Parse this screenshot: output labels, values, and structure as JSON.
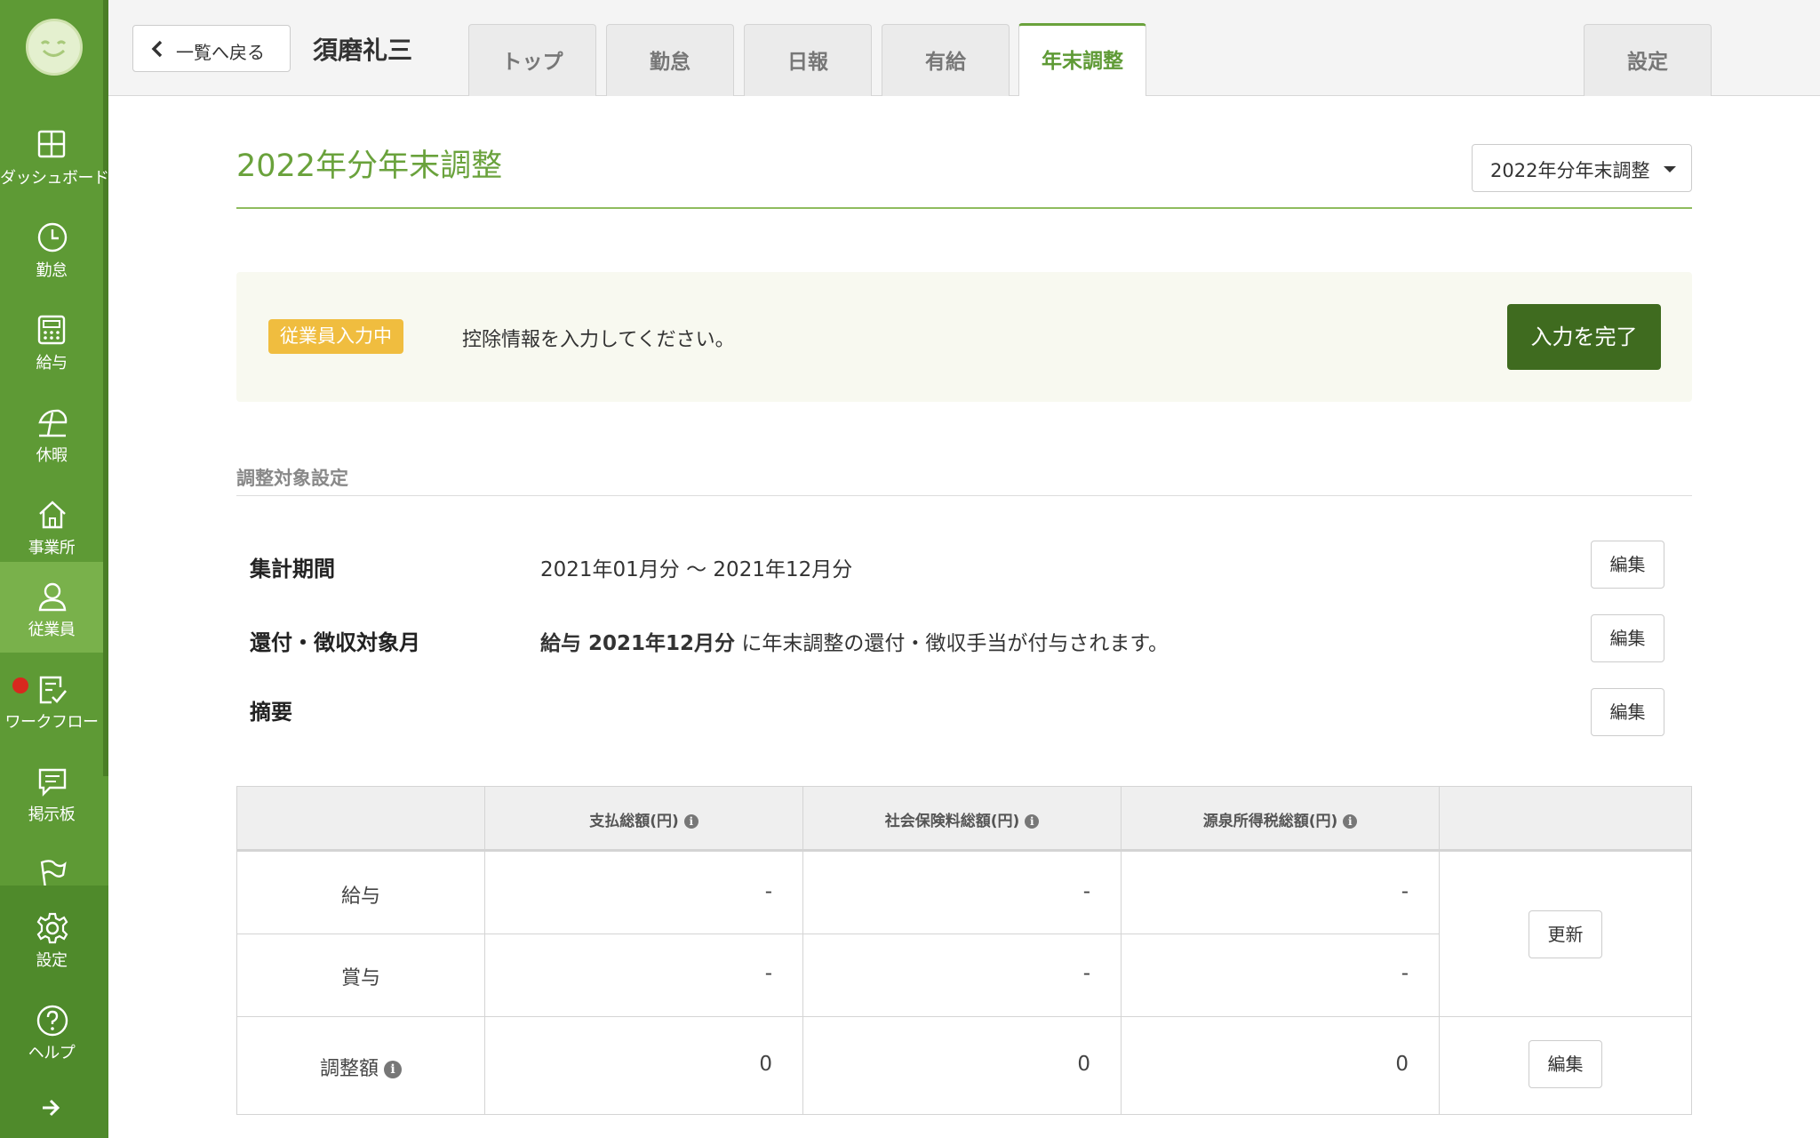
{
  "colors": {
    "sidebar_bg": "#5e9a35",
    "sidebar_active": "#79b14b",
    "accent": "#6aa23c",
    "primary_button": "#3f6b1f",
    "status_badge": "#f0bd3f",
    "notification_dot": "#d8281e"
  },
  "sidebar": {
    "items": [
      {
        "label": "ダッシュボード",
        "icon": "dashboard-icon"
      },
      {
        "label": "勤怠",
        "icon": "clock-icon"
      },
      {
        "label": "給与",
        "icon": "calculator-icon"
      },
      {
        "label": "休暇",
        "icon": "beach-umbrella-icon"
      },
      {
        "label": "事業所",
        "icon": "home-icon"
      },
      {
        "label": "従業員",
        "icon": "person-icon",
        "active": true
      },
      {
        "label": "ワークフロー",
        "icon": "workflow-check-icon",
        "badge": "notification-dot"
      },
      {
        "label": "掲示板",
        "icon": "message-board-icon"
      },
      {
        "label": "",
        "icon": "flag-icon"
      },
      {
        "label": "設定",
        "icon": "gear-icon"
      },
      {
        "label": "ヘルプ",
        "icon": "help-icon"
      }
    ],
    "collapse_icon": "arrow-right-icon"
  },
  "header": {
    "back_label": "一覧へ戻る",
    "employee_name": "須磨礼三",
    "tabs": [
      "トップ",
      "勤怠",
      "日報",
      "有給",
      "年末調整"
    ],
    "active_tab": "年末調整",
    "settings_tab": "設定"
  },
  "main": {
    "title": "2022年分年末調整",
    "year_select": "2022年分年末調整",
    "status": {
      "badge": "従業員入力中",
      "message": "控除情報を入力してください。",
      "complete_button": "入力を完了"
    },
    "section_title": "調整対象設定",
    "rows": {
      "period": {
        "label": "集計期間",
        "value": "2021年01月分 〜 2021年12月分",
        "edit": "編集"
      },
      "refund": {
        "label": "還付・徴収対象月",
        "value_bold": "給与 2021年12月分",
        "value_rest": " に年末調整の還付・徴収手当が付与されます。",
        "edit": "編集"
      },
      "summary": {
        "label": "摘要",
        "edit": "編集"
      }
    },
    "table": {
      "headers": [
        "支払総額(円)",
        "社会保険料総額(円)",
        "源泉所得税総額(円)"
      ],
      "rows": [
        {
          "label": "給与",
          "values": [
            "-",
            "-",
            "-"
          ]
        },
        {
          "label": "賞与",
          "values": [
            "-",
            "-",
            "-"
          ]
        },
        {
          "label": "調整額",
          "values": [
            "0",
            "0",
            "0"
          ]
        }
      ],
      "update_button": "更新",
      "edit_button": "編集"
    }
  }
}
